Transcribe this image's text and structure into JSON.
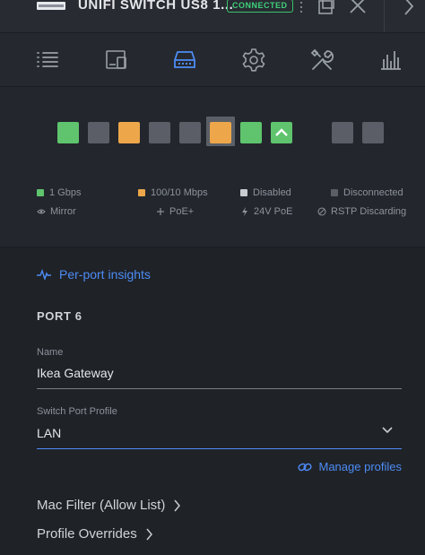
{
  "header": {
    "title": "UNIFI SWITCH US8 1...",
    "status_badge": "CONNECTED",
    "status_color": "#3fd07a",
    "icons": [
      "kebab-menu-icon",
      "window-icon",
      "close-icon",
      "chevron-right-icon"
    ]
  },
  "nav": {
    "items": [
      {
        "name": "list-icon",
        "active": false
      },
      {
        "name": "devices-icon",
        "active": false
      },
      {
        "name": "ports-icon",
        "active": true
      },
      {
        "name": "settings-gear-icon",
        "active": false
      },
      {
        "name": "tools-icon",
        "active": false
      },
      {
        "name": "statistics-icon",
        "active": false
      }
    ],
    "active_color": "#4d8cf5"
  },
  "ports": {
    "items": [
      {
        "number": 1,
        "state": "1gbps"
      },
      {
        "number": 2,
        "state": "disconnected"
      },
      {
        "number": 3,
        "state": "100/10mbps"
      },
      {
        "number": 4,
        "state": "disconnected"
      },
      {
        "number": 5,
        "state": "disconnected"
      },
      {
        "number": 6,
        "state": "100/10mbps",
        "selected": true
      },
      {
        "number": 7,
        "state": "1gbps"
      },
      {
        "number": 8,
        "state": "1gbps",
        "uplink": true
      },
      {
        "number": 9,
        "state": "disconnected"
      },
      {
        "number": 10,
        "state": "disconnected"
      }
    ],
    "colors": {
      "1gbps": "#5fc46d",
      "100/10mbps": "#eda74a",
      "disconnected": "#5b5e66",
      "disabled": "#c9ccd1"
    }
  },
  "legend": {
    "gbps": "1 Gbps",
    "mbps": "100/10 Mbps",
    "disabled": "Disabled",
    "disconnected": "Disconnected",
    "mirror": "Mirror",
    "poe_plus": "PoE+",
    "poe_24v": "24V PoE",
    "rstp": "RSTP Discarding"
  },
  "details": {
    "insights_link": "Per-port insights",
    "port_title": "PORT 6",
    "name_label": "Name",
    "name_value": "Ikea Gateway",
    "profile_label": "Switch Port Profile",
    "profile_value": "LAN",
    "manage_profiles": "Manage profiles",
    "mac_filter": "Mac Filter (Allow List)",
    "profile_overrides": "Profile Overrides"
  }
}
